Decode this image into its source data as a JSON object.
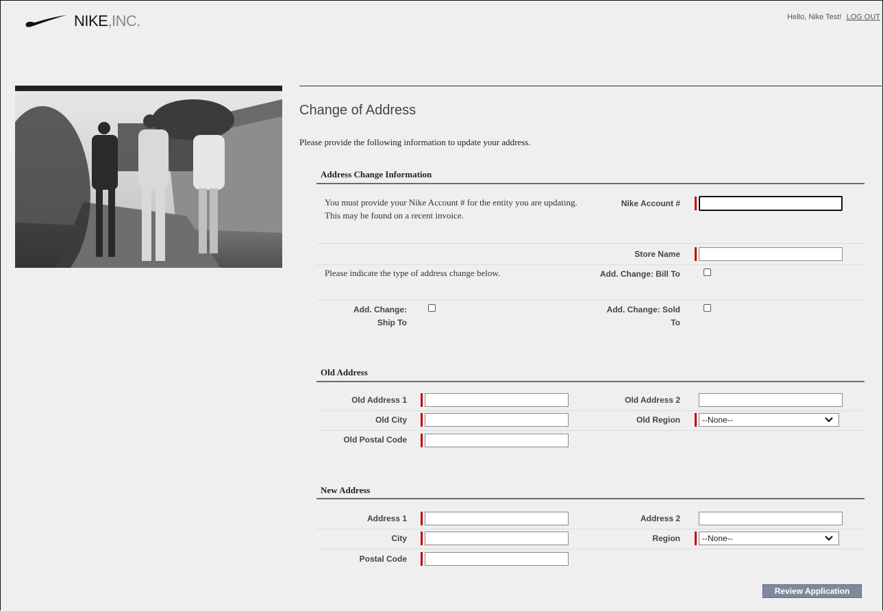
{
  "brand": {
    "name": "NIKE",
    "suffix": "INC."
  },
  "header": {
    "greeting": "Hello, Nike Test!",
    "logout_label": "LOG OUT"
  },
  "page": {
    "title": "Change of Address",
    "intro": "Please provide the following information to update your address."
  },
  "address_change": {
    "heading": "Address Change Information",
    "account_help": "You must provide your Nike Account # for the entity you are updating. This may be found on a recent invoice.",
    "account_label": "Nike Account #",
    "account_value": "",
    "store_label": "Store Name",
    "store_value": "",
    "type_help": "Please indicate the type of address change below.",
    "bill_to_label": "Add. Change: Bill To",
    "ship_to_label": "Add. Change: Ship To",
    "sold_to_label": "Add. Change: Sold To"
  },
  "old_address": {
    "heading": "Old Address",
    "address1_label": "Old Address 1",
    "address2_label": "Old Address 2",
    "city_label": "Old City",
    "region_label": "Old Region",
    "region_value": "--None--",
    "postal_label": "Old Postal Code"
  },
  "new_address": {
    "heading": "New Address",
    "address1_label": "Address 1",
    "address2_label": "Address 2",
    "city_label": "City",
    "region_label": "Region",
    "region_value": "--None--",
    "postal_label": "Postal Code"
  },
  "actions": {
    "review_label": "Review Application"
  },
  "colors": {
    "required": "#c00000",
    "button": "#7d8a9c",
    "background": "#efefef"
  }
}
